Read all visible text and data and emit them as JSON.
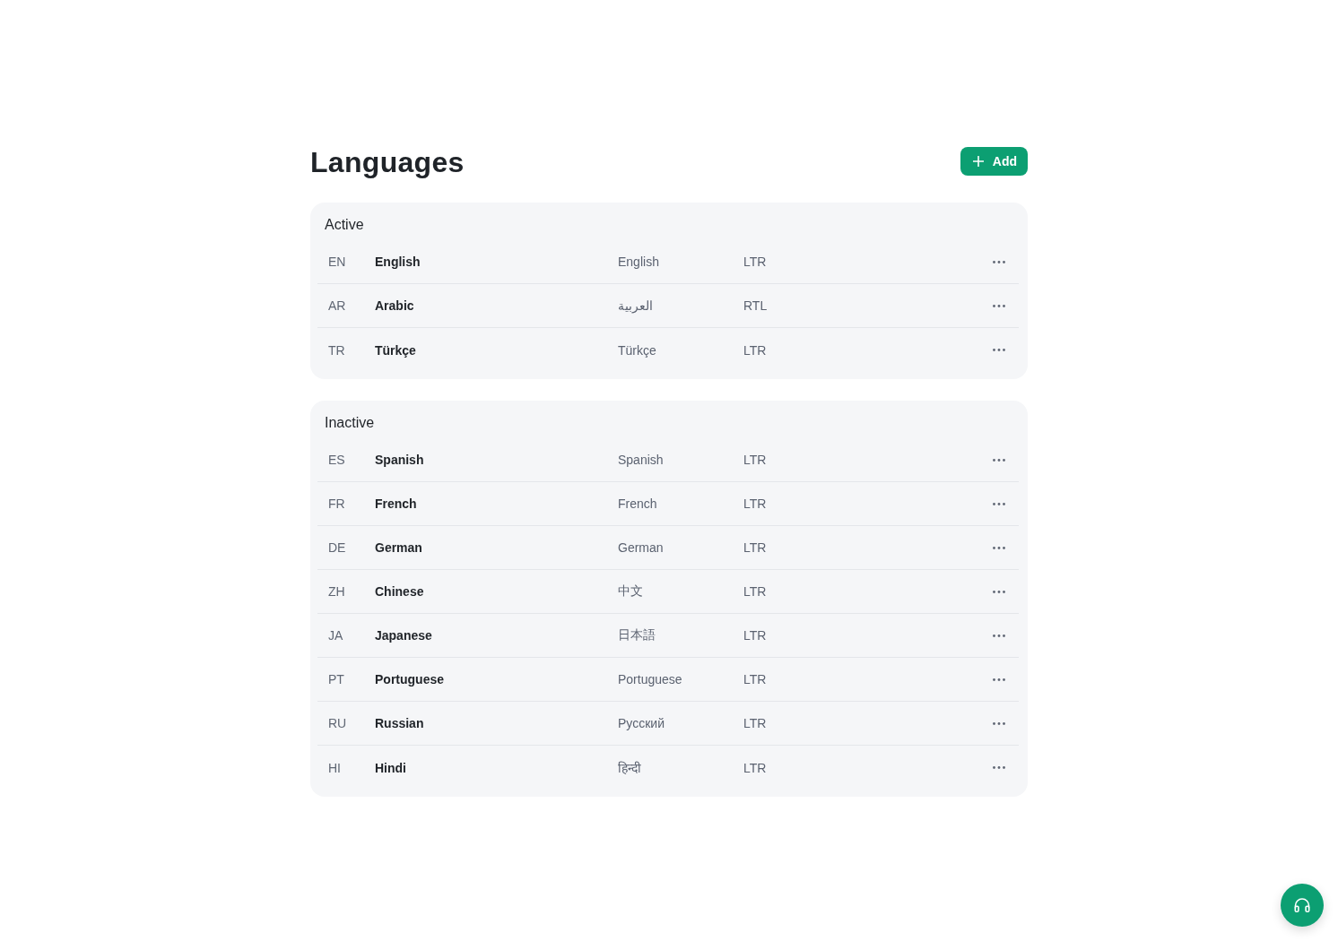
{
  "header": {
    "title": "Languages",
    "add_button": {
      "label": "Add"
    }
  },
  "groups": [
    {
      "title": "Active",
      "languages": [
        {
          "code": "EN",
          "name": "English",
          "native_name": "English",
          "direction": "LTR"
        },
        {
          "code": "AR",
          "name": "Arabic",
          "native_name": "العربية",
          "direction": "RTL"
        },
        {
          "code": "TR",
          "name": "Türkçe",
          "native_name": "Türkçe",
          "direction": "LTR"
        }
      ]
    },
    {
      "title": "Inactive",
      "languages": [
        {
          "code": "ES",
          "name": "Spanish",
          "native_name": "Spanish",
          "direction": "LTR"
        },
        {
          "code": "FR",
          "name": "French",
          "native_name": "French",
          "direction": "LTR"
        },
        {
          "code": "DE",
          "name": "German",
          "native_name": "German",
          "direction": "LTR"
        },
        {
          "code": "ZH",
          "name": "Chinese",
          "native_name": "中文",
          "direction": "LTR"
        },
        {
          "code": "JA",
          "name": "Japanese",
          "native_name": "日本語",
          "direction": "LTR"
        },
        {
          "code": "PT",
          "name": "Portuguese",
          "native_name": "Portuguese",
          "direction": "LTR"
        },
        {
          "code": "RU",
          "name": "Russian",
          "native_name": "Русский",
          "direction": "LTR"
        },
        {
          "code": "HI",
          "name": "Hindi",
          "native_name": "हिन्दी",
          "direction": "LTR"
        }
      ]
    }
  ]
}
